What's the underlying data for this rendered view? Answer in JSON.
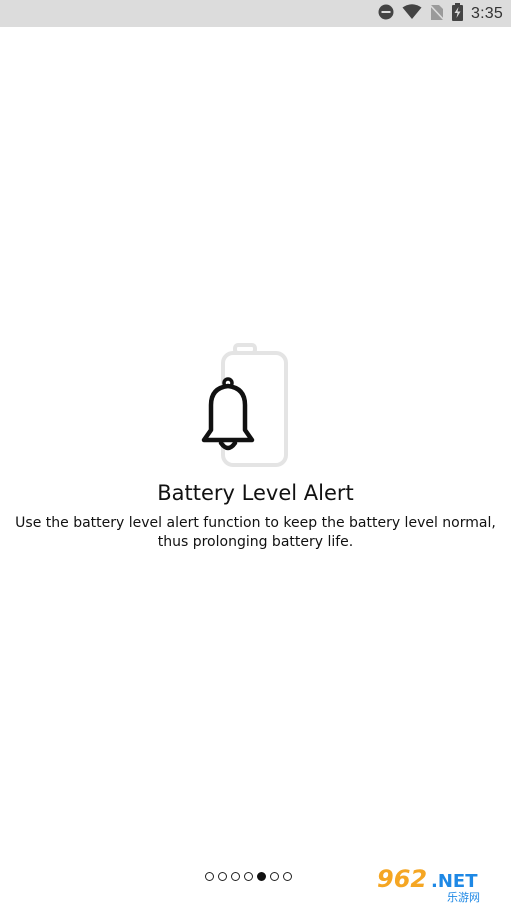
{
  "status_bar": {
    "time": "3:35",
    "icons": [
      "do-not-disturb-icon",
      "wifi-icon",
      "no-sim-icon",
      "battery-charging-icon"
    ]
  },
  "slide": {
    "title": "Battery Level Alert",
    "description": "Use the battery level alert function to keep the battery level normal, thus prolonging battery life.",
    "hero_icons": [
      "bell-icon",
      "battery-outline-icon"
    ]
  },
  "pager": {
    "total": 7,
    "active_index": 4
  },
  "watermark": {
    "brand": "962.NET",
    "subtitle": "乐游网",
    "colors": [
      "#f5a623",
      "#1e88e5"
    ]
  }
}
